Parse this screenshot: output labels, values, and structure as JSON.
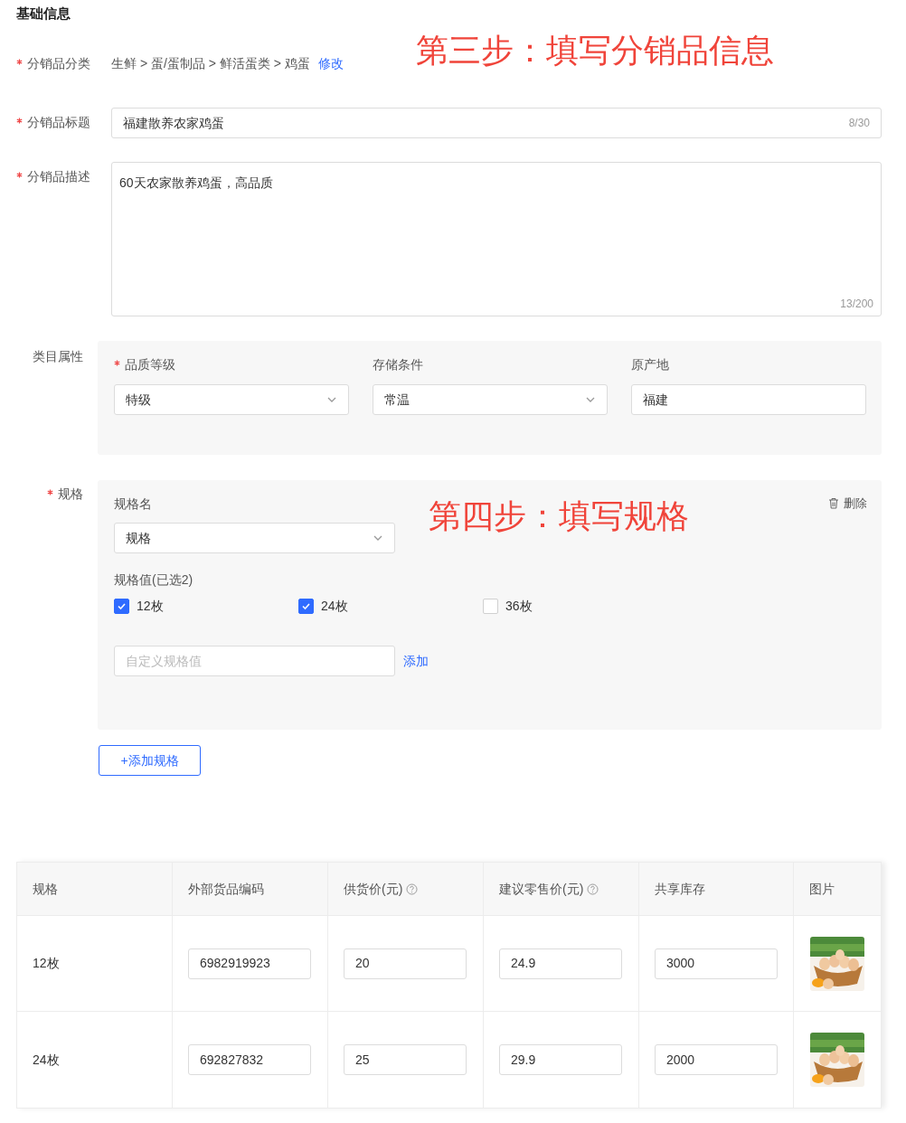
{
  "section_title": "基础信息",
  "category": {
    "label": "分销品分类",
    "required": true,
    "path": "生鲜 > 蛋/蛋制品 > 鲜活蛋类 > 鸡蛋",
    "edit_link": "修改"
  },
  "step_three_note": "第三步：填写分销品信息",
  "title_field": {
    "label": "分销品标题",
    "required": true,
    "value": "福建散养农家鸡蛋",
    "counter": "8/30"
  },
  "description_field": {
    "label": "分销品描述",
    "required": true,
    "value": "60天农家散养鸡蛋，高品质",
    "counter": "13/200"
  },
  "attributes": {
    "label": "类目属性",
    "required": false,
    "fields": [
      {
        "label": "品质等级",
        "required": true,
        "kind": "select",
        "value": "特级"
      },
      {
        "label": "存储条件",
        "required": false,
        "kind": "select",
        "value": "常温"
      },
      {
        "label": "原产地",
        "required": false,
        "kind": "input",
        "value": "福建"
      }
    ]
  },
  "spec": {
    "label": "规格",
    "required": true,
    "name_label": "规格名",
    "name_value": "规格",
    "delete_label": "删除",
    "step_four_note": "第四步：填写规格",
    "values_label": "规格值(已选2)",
    "options": [
      {
        "label": "12枚",
        "checked": true
      },
      {
        "label": "24枚",
        "checked": true
      },
      {
        "label": "36枚",
        "checked": false
      }
    ],
    "custom_placeholder": "自定义规格值",
    "add_link": "添加"
  },
  "add_spec_button": "+添加规格",
  "table": {
    "columns": [
      {
        "label": "规格",
        "help": false
      },
      {
        "label": "外部货品编码",
        "help": false
      },
      {
        "label": "供货价(元)",
        "help": true
      },
      {
        "label": "建议零售价(元)",
        "help": true
      },
      {
        "label": "共享库存",
        "help": false
      },
      {
        "label": "图片",
        "help": false
      }
    ],
    "rows": [
      {
        "spec": "12枚",
        "inputs": [
          "6982919923",
          "20",
          "24.9",
          "3000"
        ]
      },
      {
        "spec": "24枚",
        "inputs": [
          "692827832",
          "25",
          "29.9",
          "2000"
        ]
      }
    ]
  }
}
